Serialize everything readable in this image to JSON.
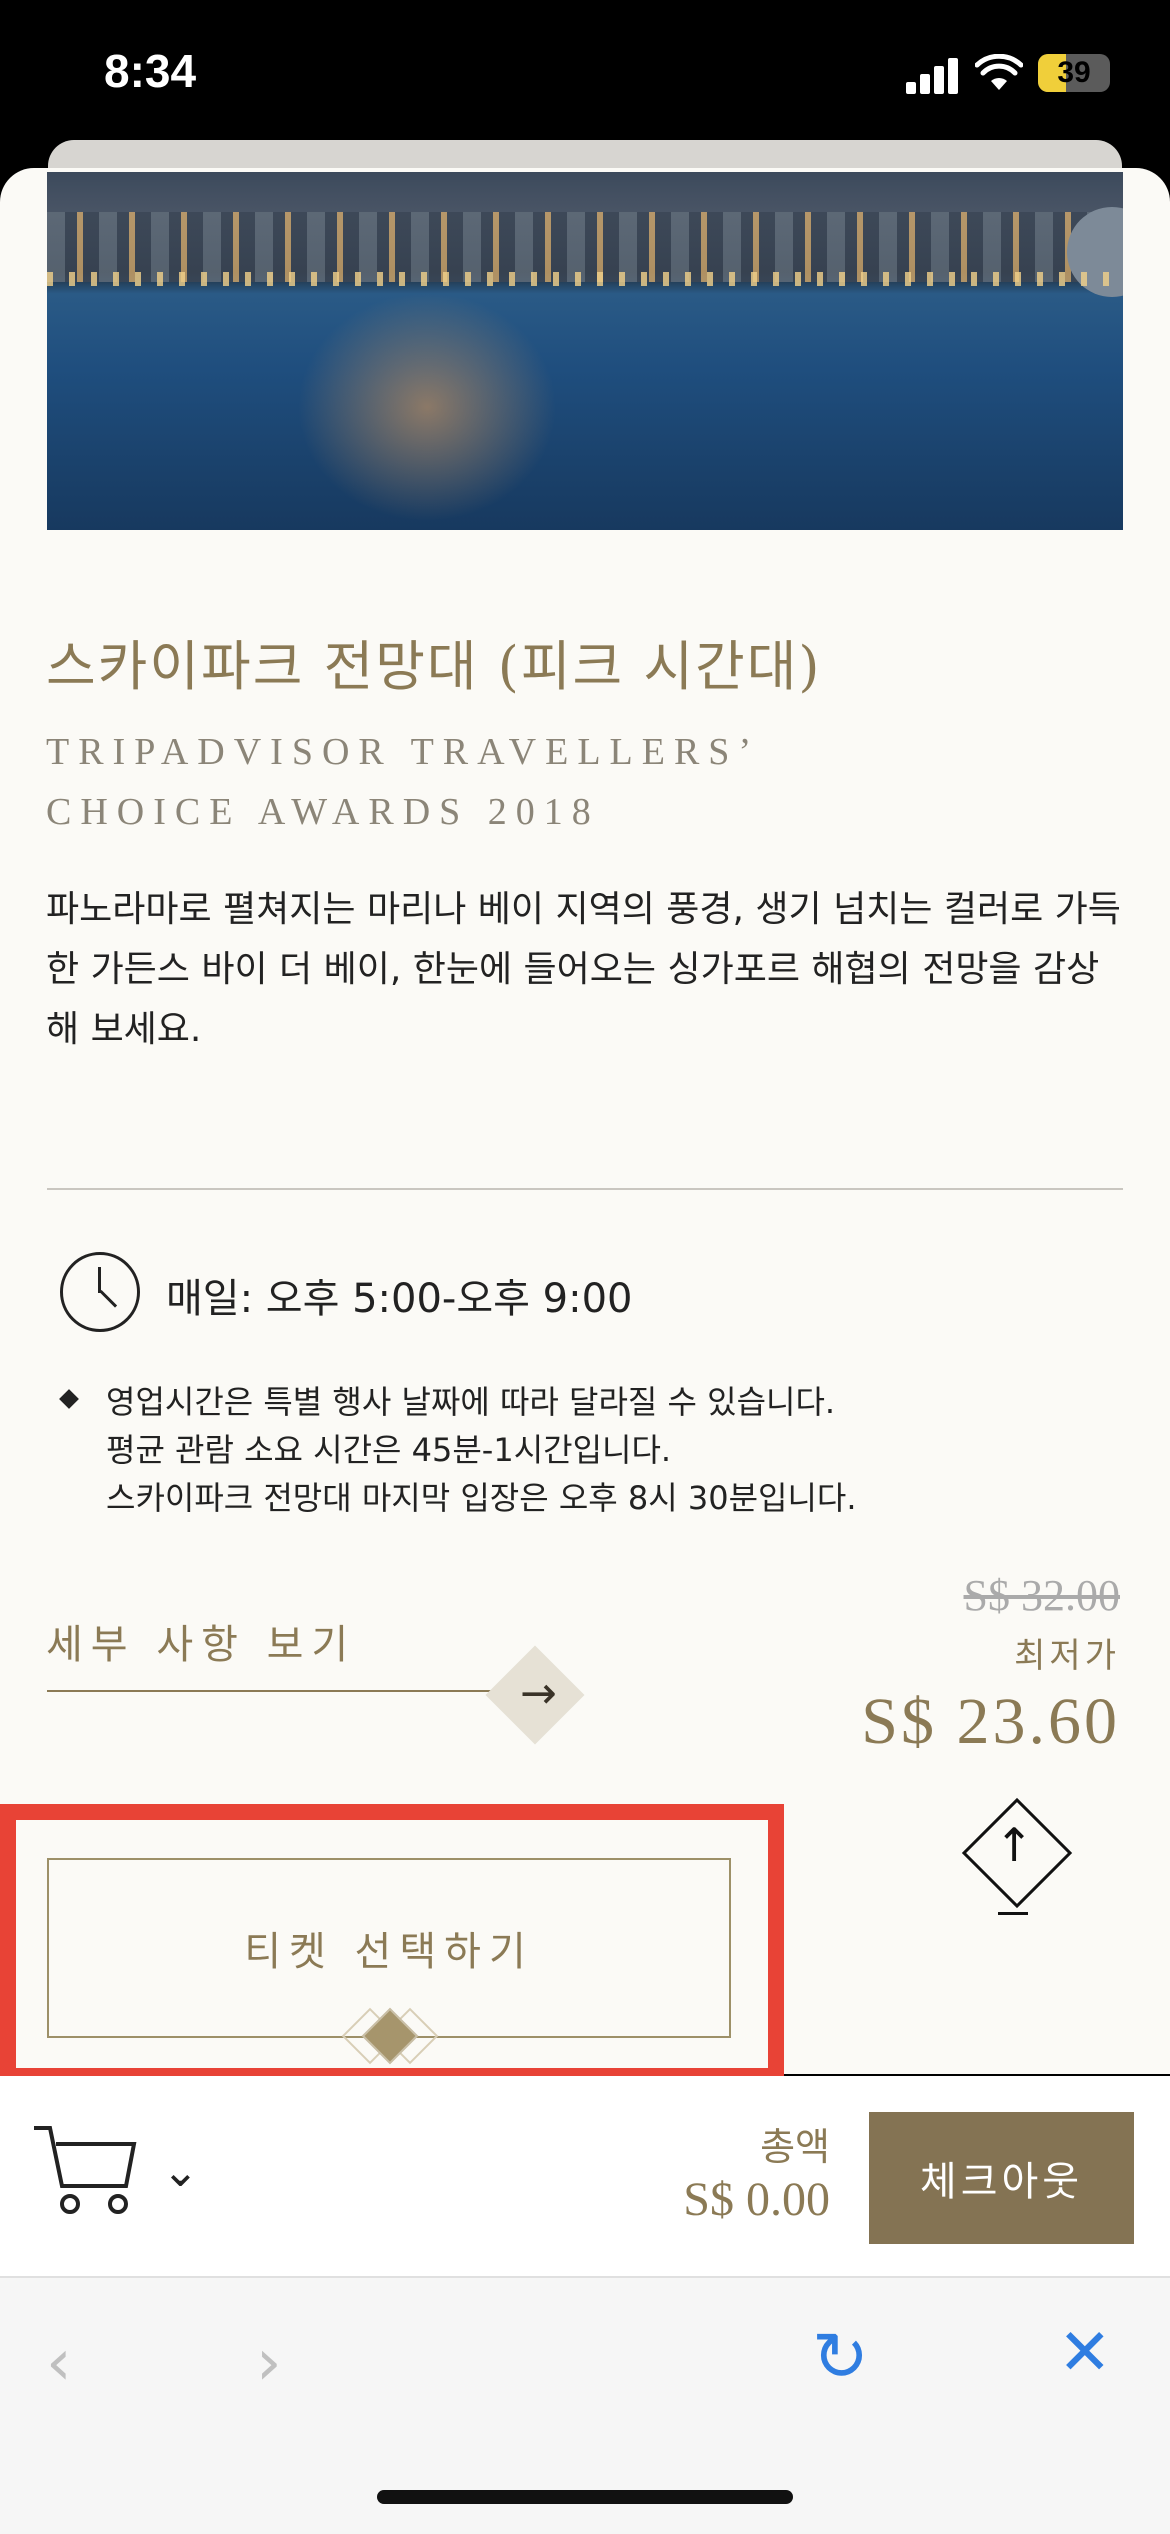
{
  "status_bar": {
    "time": "8:34",
    "battery": "39"
  },
  "attraction": {
    "title": "스카이파크 전망대 (피크 시간대)",
    "award_line1": "TRIPADVISOR TRAVELLERS’",
    "award_line2": "CHOICE AWARDS 2018",
    "description": "파노라마로 펼쳐지는 마리나 베이 지역의 풍경, 생기 넘치는 컬러로 가득한 가든스 바이 더 베이, 한눈에 들어오는 싱가포르 해협의 전망을 감상해 보세요.",
    "hours": "매일: 오후 5:00-오후 9:00",
    "notes": [
      "영업시간은 특별 행사 날짜에 따라 달라질 수 있습니다.",
      "평균 관람 소요 시간은 45분-1시간입니다.",
      "스카이파크 전망대 마지막 입장은 오후 8시 30분입니다."
    ],
    "details_link": "세부 사항 보기",
    "original_price": "S$ 32.00",
    "lowest_label": "최저가",
    "price": "S$ 23.60",
    "select_button": "티켓 선택하기"
  },
  "cart": {
    "total_label": "총액",
    "total_value": "S$ 0.00",
    "checkout_label": "체크아웃"
  },
  "browser": {
    "back": "‹",
    "forward": "›",
    "reload": "↻",
    "close": "✕"
  },
  "colors": {
    "gold": "#8b7a55",
    "checkout": "#847353",
    "highlight": "#e84336",
    "browser_blue": "#2f7de1"
  }
}
